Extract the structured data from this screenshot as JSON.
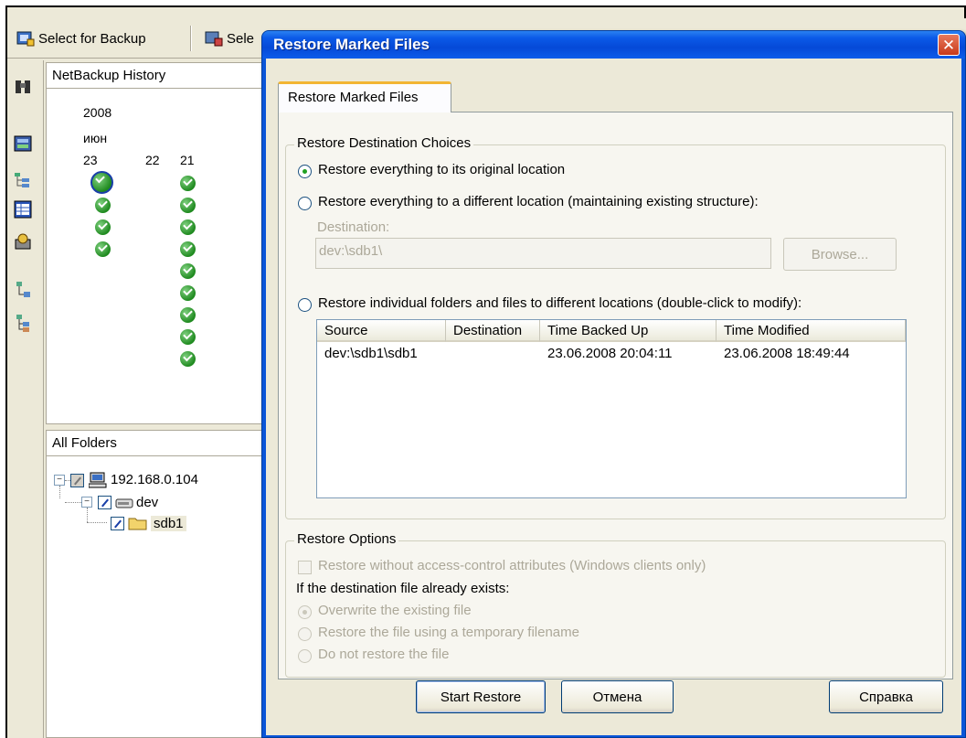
{
  "toolbar": {
    "select_for_backup": "Select for Backup",
    "select_cut": "Sele"
  },
  "history": {
    "title": "NetBackup History",
    "year": "2008",
    "month": "июн",
    "days": [
      "23",
      "22",
      "21"
    ]
  },
  "folders": {
    "title": "All Folders",
    "host": "192.168.0.104",
    "dev": "dev",
    "sdb1": "sdb1"
  },
  "dialog": {
    "title": "Restore Marked Files",
    "tab_label": "Restore Marked Files",
    "dest_group_label": "Restore Destination Choices",
    "option_original": "Restore everything to its original location",
    "option_different": "Restore everything to a different location (maintaining existing structure):",
    "destination_label": "Destination:",
    "destination_value": "dev:\\sdb1\\",
    "browse_label": "Browse...",
    "option_individual": "Restore individual folders and files to different locations (double-click to modify):",
    "list": {
      "columns": [
        "Source",
        "Destination",
        "Time Backed Up",
        "Time Modified"
      ],
      "rows": [
        {
          "source": "dev:\\sdb1\\sdb1",
          "destination": "",
          "time_backed_up": "23.06.2008 20:04:11",
          "time_modified": "23.06.2008 18:49:44"
        }
      ]
    },
    "options_group_label": "Restore Options",
    "option_acl": "Restore without access-control attributes (Windows clients only)",
    "exists_label": "If the destination file already exists:",
    "exists_overwrite": "Overwrite the existing file",
    "exists_temp": "Restore the file using a temporary filename",
    "exists_skip": "Do not restore the file",
    "start_button": "Start Restore",
    "cancel_button": "Отмена",
    "help_button": "Справка"
  },
  "colors": {
    "title_bar": "#0b5ae8",
    "dialog_face": "#ece9d8",
    "close_button": "#c83a1a",
    "success_check": "#1f8a1f"
  }
}
